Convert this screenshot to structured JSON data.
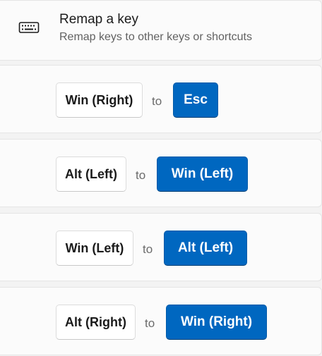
{
  "header": {
    "icon": "keyboard-icon",
    "title": "Remap a key",
    "subtitle": "Remap keys to other keys or shortcuts"
  },
  "remaps": [
    {
      "from": "Win (Right)",
      "connector": "to",
      "to": "Esc"
    },
    {
      "from": "Alt (Left)",
      "connector": "to",
      "to": "Win (Left)"
    },
    {
      "from": "Win (Left)",
      "connector": "to",
      "to": "Alt (Left)"
    },
    {
      "from": "Alt (Right)",
      "connector": "to",
      "to": "Win (Right)"
    }
  ],
  "colors": {
    "accent": "#0067c0",
    "card": "#fbfbfb",
    "background": "#f3f3f3"
  }
}
